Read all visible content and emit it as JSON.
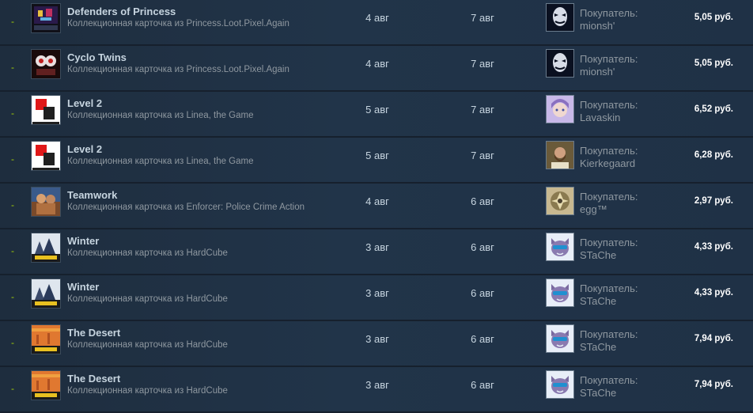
{
  "marker": "-",
  "buyer_label": "Покупатель:",
  "rows": [
    {
      "name": "Defenders of Princess",
      "game": "Коллекционная карточка из Princess.Loot.Pixel.Again",
      "listed": "4 авг",
      "acted": "7 авг",
      "buyer": "mionsh'",
      "price": "5,05 руб.",
      "thumb_icon": "defenders-card-icon",
      "avatar_icon": "mask-avatar-icon"
    },
    {
      "name": "Cyclo Twins",
      "game": "Коллекционная карточка из Princess.Loot.Pixel.Again",
      "listed": "4 авг",
      "acted": "7 авг",
      "buyer": "mionsh'",
      "price": "5,05 руб.",
      "thumb_icon": "cyclo-twins-card-icon",
      "avatar_icon": "mask-avatar-icon"
    },
    {
      "name": "Level 2",
      "game": "Коллекционная карточка из Linea, the Game",
      "listed": "5 авг",
      "acted": "7 авг",
      "buyer": "Lavaskin",
      "price": "6,52 руб.",
      "thumb_icon": "linea-card-icon",
      "avatar_icon": "anime-avatar-icon"
    },
    {
      "name": "Level 2",
      "game": "Коллекционная карточка из Linea, the Game",
      "listed": "5 авг",
      "acted": "7 авг",
      "buyer": "Kierkegaard",
      "price": "6,28 руб.",
      "thumb_icon": "linea-card-icon",
      "avatar_icon": "bearded-man-avatar-icon"
    },
    {
      "name": "Teamwork",
      "game": "Коллекционная карточка из Enforcer: Police Crime Action",
      "listed": "4 авг",
      "acted": "6 авг",
      "buyer": "egg™",
      "price": "2,97 руб.",
      "thumb_icon": "teamwork-card-icon",
      "avatar_icon": "emblem-avatar-icon"
    },
    {
      "name": "Winter",
      "game": "Коллекционная карточка из HardCube",
      "listed": "3 авг",
      "acted": "6 авг",
      "buyer": "STaChe",
      "price": "4,33 руб.",
      "thumb_icon": "hardcube-winter-card-icon",
      "avatar_icon": "cat-avatar-icon"
    },
    {
      "name": "Winter",
      "game": "Коллекционная карточка из HardCube",
      "listed": "3 авг",
      "acted": "6 авг",
      "buyer": "STaChe",
      "price": "4,33 руб.",
      "thumb_icon": "hardcube-winter-card-icon",
      "avatar_icon": "cat-avatar-icon"
    },
    {
      "name": "The Desert",
      "game": "Коллекционная карточка из HardCube",
      "listed": "3 авг",
      "acted": "6 авг",
      "buyer": "STaChe",
      "price": "7,94 руб.",
      "thumb_icon": "hardcube-desert-card-icon",
      "avatar_icon": "cat-avatar-icon"
    },
    {
      "name": "The Desert",
      "game": "Коллекционная карточка из HardCube",
      "listed": "3 авг",
      "acted": "6 авг",
      "buyer": "STaChe",
      "price": "7,94 руб.",
      "thumb_icon": "hardcube-desert-card-icon",
      "avatar_icon": "cat-avatar-icon"
    }
  ]
}
